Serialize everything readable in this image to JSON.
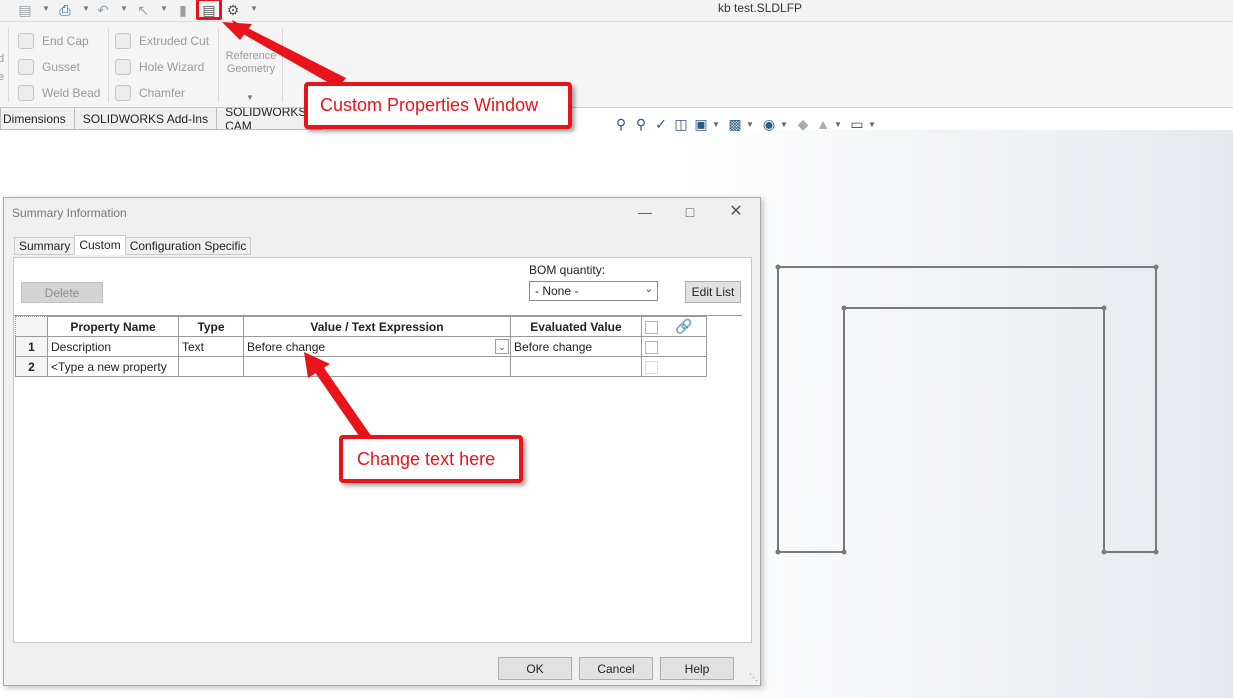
{
  "window": {
    "title": "kb test.SLDLFP"
  },
  "ribbon": {
    "items": [
      {
        "label": "End Cap"
      },
      {
        "label": "Gusset"
      },
      {
        "label": "Weld Bead"
      },
      {
        "label": "Extruded Cut"
      },
      {
        "label": "Hole Wizard"
      },
      {
        "label": "Chamfer"
      }
    ],
    "reference_geometry": "Reference Geometry",
    "edge_labels": [
      "d",
      "e"
    ]
  },
  "command_tabs": [
    "Dimensions",
    "SOLIDWORKS Add-Ins",
    "SOLIDWORKS CAM"
  ],
  "dialog": {
    "title": "Summary Information",
    "tabs": [
      "Summary",
      "Custom",
      "Configuration Specific"
    ],
    "active_tab": "Custom",
    "delete_label": "Delete",
    "bom_label": "BOM quantity:",
    "bom_value": "- None -",
    "edit_list_label": "Edit List",
    "columns": [
      "Property Name",
      "Type",
      "Value / Text Expression",
      "Evaluated Value"
    ],
    "rows": [
      {
        "num": "1",
        "name": "Description",
        "type": "Text",
        "value": "Before change",
        "evaluated": "Before change"
      },
      {
        "num": "2",
        "name": "<Type a new property",
        "type": "",
        "value": "",
        "evaluated": ""
      }
    ],
    "ok_label": "OK",
    "cancel_label": "Cancel",
    "help_label": "Help"
  },
  "callouts": {
    "custom_properties": "Custom Properties Window",
    "change_text": "Change text here"
  },
  "colors": {
    "accent": "#e8141b",
    "dialog_bg": "#f0f0f0"
  },
  "icons": [
    "save-icon",
    "print-icon",
    "undo-icon",
    "select-icon",
    "custom-properties-icon",
    "options-gear-icon"
  ]
}
